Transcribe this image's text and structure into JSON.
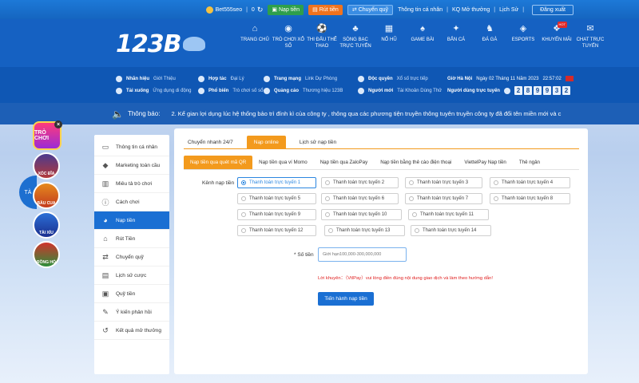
{
  "topbar": {
    "username": "Bet555seo",
    "balance": "0",
    "deposit_label": "Nạp tiền",
    "withdraw_label": "Rút tiền",
    "transfer_label": "Chuyển quỹ",
    "links": [
      "Thông tin cá nhân",
      "KQ Mở thưởng",
      "Lịch Sử"
    ],
    "logout_label": "Đăng xuất"
  },
  "header": {
    "logo_text": "123B",
    "nav": [
      {
        "label": "TRANG CHỦ",
        "icon": "home-icon"
      },
      {
        "label": "TRÒ CHƠI XỔ SỐ",
        "icon": "lottery-icon"
      },
      {
        "label": "THI ĐẤU THỂ THAO",
        "icon": "sports-icon"
      },
      {
        "label": "SÒNG BẠC TRỰC TUYẾN",
        "icon": "casino-icon"
      },
      {
        "label": "NỔ HŨ",
        "icon": "slot-icon"
      },
      {
        "label": "GAME BÀI",
        "icon": "cards-icon"
      },
      {
        "label": "BẮN CÁ",
        "icon": "fish-icon"
      },
      {
        "label": "ĐÁ GÀ",
        "icon": "rooster-icon"
      },
      {
        "label": "ESPORTS",
        "icon": "esports-icon"
      },
      {
        "label": "KHUYẾN MÃI",
        "icon": "gift-icon",
        "badge": "HOT"
      },
      {
        "label": "CHAT TRỰC TUYẾN",
        "icon": "chat-icon"
      }
    ]
  },
  "info": {
    "col1": [
      {
        "label": "Nhãn hiệu",
        "sub": "Giới Thiệu"
      },
      {
        "label": "Tải xuống",
        "sub": "Ứng dụng di động"
      }
    ],
    "col2": [
      {
        "label": "Hợp tác",
        "sub": "Đại Lý"
      },
      {
        "label": "Phổ biến",
        "sub": "Trò chơi số sổ"
      }
    ],
    "col3": [
      {
        "label": "Trang mạng",
        "sub": "Link Dự Phòng"
      },
      {
        "label": "Quảng cáo",
        "sub": "Thương hiệu 123B"
      }
    ],
    "col4": [
      {
        "label": "Độc quyền",
        "sub": "Xổ số trực tiếp"
      },
      {
        "label": "Người mới",
        "sub": "Tài Khoản Dùng Thử"
      }
    ],
    "time_label": "Giờ Hà Nội",
    "date_text": "Ngày 02 Tháng 11 Năm 2023",
    "time_text": "22:57:02",
    "online_label": "Người dùng trực tuyến",
    "online_digits": [
      "2",
      "8",
      "9",
      "9",
      "3",
      "2"
    ]
  },
  "announce": {
    "label": "Thông báo:",
    "text": "2. Kể gian lợi dụng lúc hệ thống bảo trì đính kì của công ty , thông qua các phương tiện truyền thông tuyên truyền công ty đã đổi tên miền mới và c"
  },
  "float_games": {
    "main": "TRÒ CHƠI",
    "items": [
      "XÓC ĐĨA",
      "BẦU CUA",
      "TÀI XỈU",
      "RỒNG HỔ"
    ],
    "left_tab": "TÀ"
  },
  "sidebar": {
    "items": [
      {
        "label": "Thông tin cá nhân",
        "icon": "id-card-icon"
      },
      {
        "label": "Marketing toàn cầu",
        "icon": "diamond-icon"
      },
      {
        "label": "Miêu tả trò chơi",
        "icon": "book-icon"
      },
      {
        "label": "Cách chơi",
        "icon": "info-icon"
      },
      {
        "label": "Nạp tiền",
        "icon": "piggy-bank-icon",
        "active": true
      },
      {
        "label": "Rút Tiền",
        "icon": "bank-icon"
      },
      {
        "label": "Chuyển quỹ",
        "icon": "transfer-icon"
      },
      {
        "label": "Lịch sử cược",
        "icon": "clipboard-icon"
      },
      {
        "label": "Quỹ tiền",
        "icon": "wallet-icon"
      },
      {
        "label": "Ý kiến phản hồi",
        "icon": "feedback-icon"
      },
      {
        "label": "Kết quả mở thưởng",
        "icon": "history-icon"
      }
    ]
  },
  "content": {
    "tabs": [
      "Chuyển nhanh 24/7",
      "Nạp online",
      "Lịch sử nạp tiền"
    ],
    "active_tab": 1,
    "subtabs": [
      "Nạp tiền qua quét mã QR",
      "Nạp tiền qua ví Momo",
      "Nạp tiền qua ZaloPay",
      "Nạp tiền bằng thẻ cào điện thoại",
      "ViettelPay Nạp tiền",
      "Thẻ ngân"
    ],
    "active_subtab": 0,
    "channel_label": "Kênh nạp tiền",
    "options": [
      "Thanh toán trực tuyến 1",
      "Thanh toán trực tuyến 2",
      "Thanh toán trực tuyến 3",
      "Thanh toán trực tuyến 4",
      "Thanh toán trực tuyến 5",
      "Thanh toán trực tuyến 6",
      "Thanh toán trực tuyến 7",
      "Thanh toán trực tuyến 8",
      "Thanh toán trực tuyến 9",
      "Thanh toán trực tuyến 10",
      "Thanh toán trực tuyến 11",
      "Thanh toán trực tuyến 12",
      "Thanh toán trực tuyến 13",
      "Thanh toán trực tuyến 14"
    ],
    "selected_option": 0,
    "amount_label": "* Số tiền",
    "amount_placeholder": "Giới hạn100,000-300,000,000",
    "note": "Lời khuyên：（VtlPay）vui lòng điền đúng nội dung giao dịch và làm theo hướng dẫn!",
    "submit_label": "Tiến hành nạp tiền"
  },
  "colors": {
    "primary": "#1a6fd3",
    "accent": "#f39a1d",
    "danger": "#e02020"
  }
}
